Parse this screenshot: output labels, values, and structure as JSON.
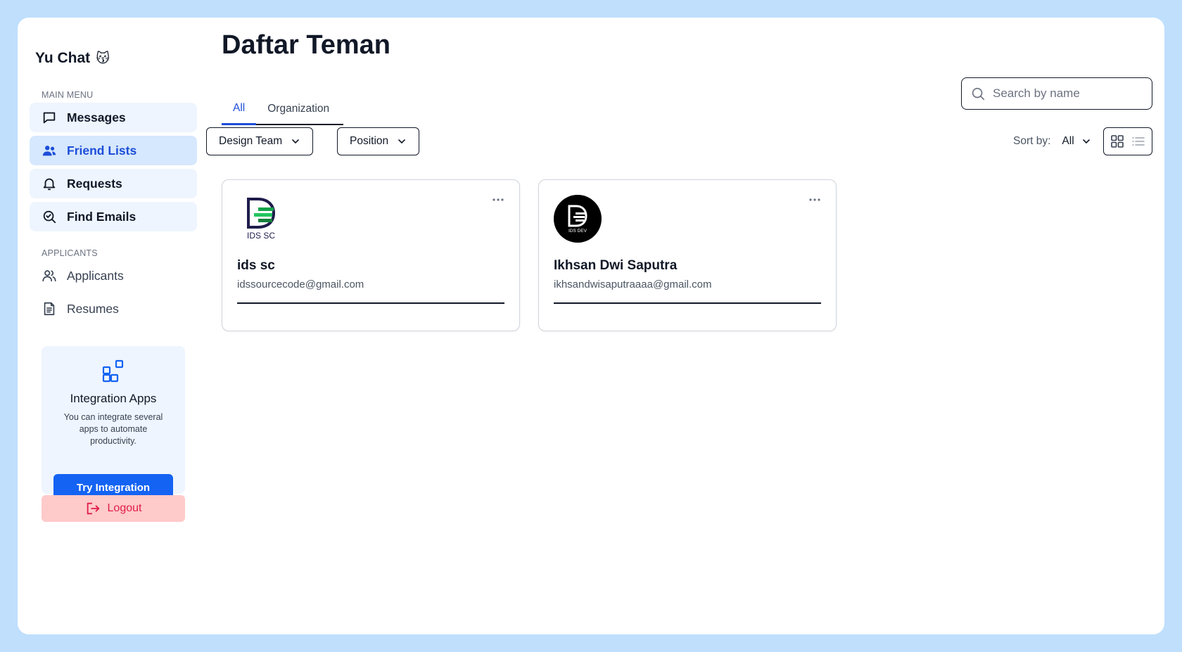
{
  "app": {
    "brand": "Yu Chat",
    "brand_emoji": "😽"
  },
  "sidebar": {
    "main_menu_label": "MAIN MENU",
    "main_items": [
      {
        "label": "Messages",
        "icon": "message-icon"
      },
      {
        "label": "Friend Lists",
        "icon": "users-icon",
        "active": true
      },
      {
        "label": "Requests",
        "icon": "bell-icon"
      },
      {
        "label": "Find Emails",
        "icon": "search-check-icon"
      }
    ],
    "applicants_label": "APPLICANTS",
    "applicant_items": [
      {
        "label": "Applicants",
        "icon": "users-outline-icon"
      },
      {
        "label": "Resumes",
        "icon": "document-icon"
      }
    ],
    "promo": {
      "title": "Integration Apps",
      "description": "You can integrate several apps to automate productivity.",
      "button": "Try Integration"
    },
    "logout": "Logout"
  },
  "main": {
    "title": "Daftar Teman",
    "tabs": [
      {
        "label": "All",
        "active": true
      },
      {
        "label": "Organization"
      }
    ],
    "search": {
      "placeholder": "Search by name",
      "value": ""
    },
    "filters": [
      {
        "label": "Design Team"
      },
      {
        "label": "Position"
      }
    ],
    "sort": {
      "label": "Sort by:",
      "value": "All"
    },
    "view_mode": "grid",
    "friends": [
      {
        "name": "ids sc",
        "email": "idssourcecode@gmail.com",
        "logo_text": "IDS SC"
      },
      {
        "name": "Ikhsan Dwi Saputra",
        "email": "ikhsandwisaputraaaa@gmail.com",
        "logo_text": "IDS DEV"
      }
    ]
  },
  "colors": {
    "background": "#bfdffd",
    "accent": "#1463f3",
    "active_text": "#1d4ed8",
    "logout_bg": "#fecaca",
    "logout_text": "#e11d48"
  }
}
